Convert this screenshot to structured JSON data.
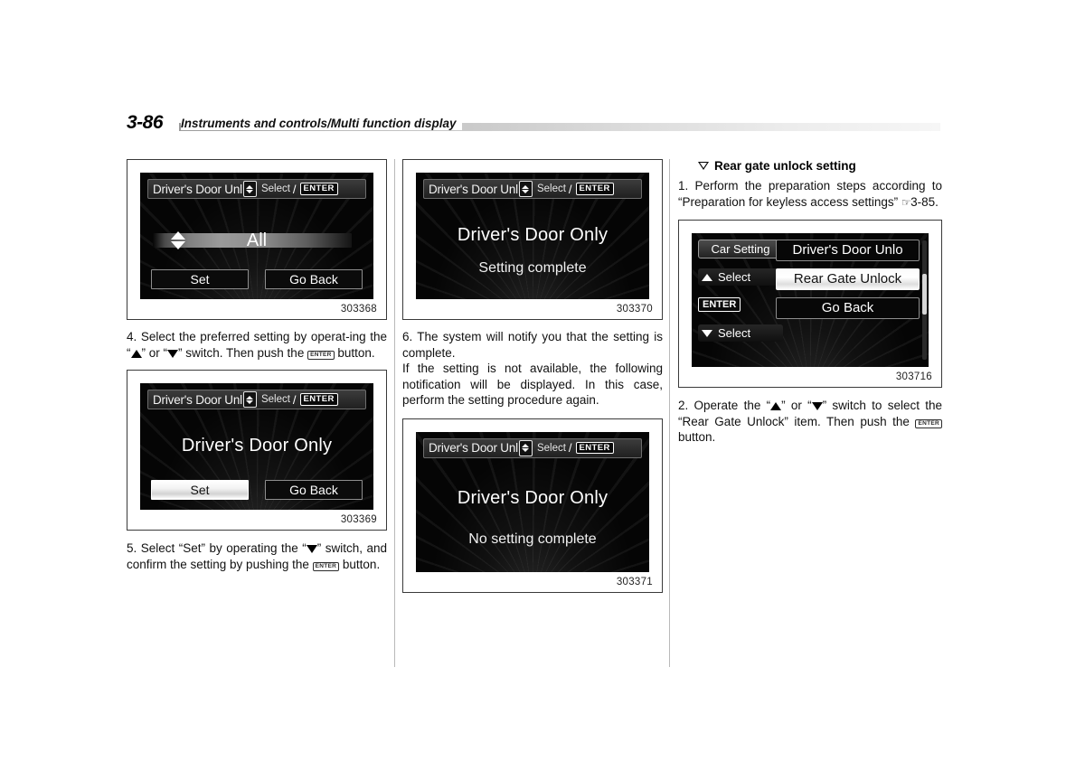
{
  "header": {
    "page_number": "3-86",
    "title": "Instruments and controls/Multi function display"
  },
  "columns": {
    "col1": {
      "figure1": {
        "caption": "303368",
        "screen": {
          "titlebar_text": "Driver's Door Unl",
          "titlebar_select": "Select",
          "titlebar_slash": "/",
          "titlebar_enter": "ENTER",
          "value": "All",
          "button_set": "Set",
          "button_go_back": "Go Back",
          "selected_button": "none"
        }
      },
      "step4": "4.  Select the preferred setting by operating the “▲” or “▼” switch. Then push the ENTER button.",
      "step4_parts": {
        "lead": "4.  Select the preferred setting by operat-ing the “",
        "mid": "” or “",
        "tail": "” switch. Then push the ",
        "end": " button."
      },
      "figure2": {
        "caption": "303369",
        "screen": {
          "titlebar_text": "Driver's Door Unl",
          "titlebar_select": "Select",
          "titlebar_slash": "/",
          "titlebar_enter": "ENTER",
          "value": "Driver's Door Only",
          "button_set": "Set",
          "button_go_back": "Go Back",
          "selected_button": "Set"
        }
      },
      "step5_parts": {
        "lead": "5. Select “Set” by operating the “",
        "tail": "” switch, and confirm the setting by pushing the ",
        "end": " button."
      }
    },
    "col2": {
      "figure1": {
        "caption": "303370",
        "screen": {
          "titlebar_text": "Driver's Door Unl",
          "titlebar_select": "Select",
          "titlebar_slash": "/",
          "titlebar_enter": "ENTER",
          "line1": "Driver's Door Only",
          "line2": "Setting complete"
        }
      },
      "step6": "6.  The system will notify you that the setting is complete.",
      "note": "If the setting is not available, the following notification will be displayed. In this case, perform the setting procedure again.",
      "figure2": {
        "caption": "303371",
        "screen": {
          "titlebar_text": "Driver's Door Unl",
          "titlebar_select": "Select",
          "titlebar_slash": "/",
          "titlebar_enter": "ENTER",
          "line1": "Driver's Door Only",
          "line2": "No setting complete"
        }
      }
    },
    "col3": {
      "section_heading": "Rear gate unlock setting",
      "step1_parts": {
        "lead": "1.  Perform the preparation steps according to “Preparation for keyless access settings” ",
        "ref_icon": "☞",
        "ref": "3-85."
      },
      "figure1": {
        "caption": "303716",
        "screen": {
          "chip_car_setting": "Car Setting",
          "select_up": "Select",
          "enter": "ENTER",
          "select_down": "Select",
          "items": [
            {
              "label": "Driver's Door Unlo",
              "highlighted": false
            },
            {
              "label": "Rear Gate Unlock",
              "highlighted": true
            },
            {
              "label": "Go Back",
              "highlighted": false
            }
          ]
        }
      },
      "step2_parts": {
        "lead": "2. Operate the “",
        "mid": "” or “",
        "tail": "” switch to select the “Rear Gate Unlock” item. Then push the ",
        "end": " button."
      }
    }
  },
  "colors": {
    "screen_background": "#050505",
    "highlight": "#ffffff",
    "text": "#111111",
    "rule": "#b9b9b9"
  }
}
